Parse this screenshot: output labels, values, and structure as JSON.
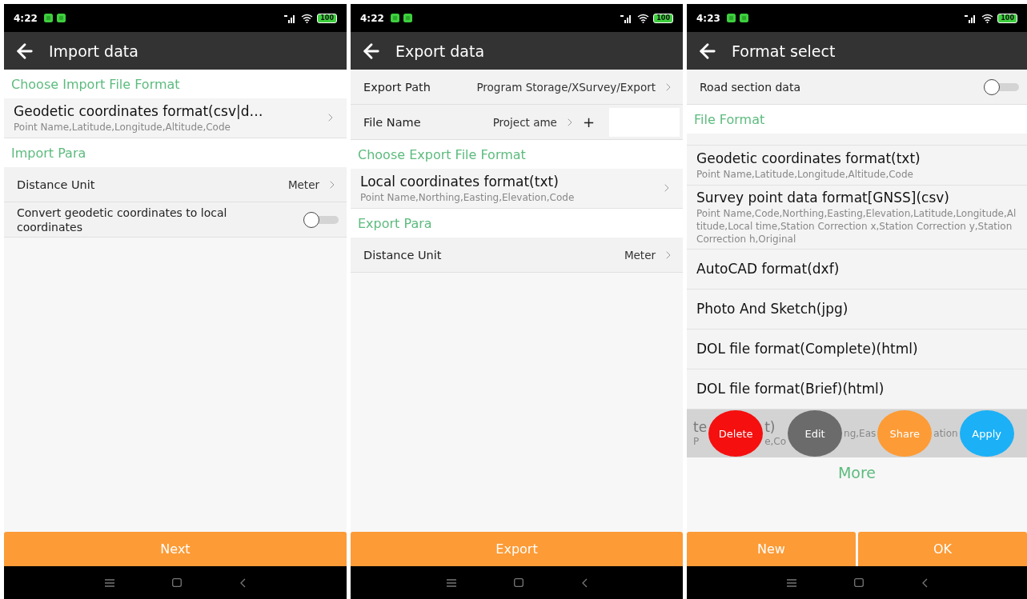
{
  "screens": [
    {
      "status": {
        "time": "4:22",
        "battery": "100"
      },
      "title": "Import data",
      "rows": [
        {
          "kind": "section",
          "label": "Choose Import File Format"
        },
        {
          "kind": "format",
          "title": "Geodetic coordinates format(csv|d…",
          "subtitle": "Point Name,Latitude,Longitude,Altitude,Code",
          "chevron": true
        },
        {
          "kind": "section",
          "label": "Import Para"
        },
        {
          "kind": "value",
          "label": "Distance Unit",
          "value": "Meter"
        },
        {
          "kind": "toggle",
          "label": "Convert geodetic coordinates to local coordinates",
          "on": false
        }
      ],
      "buttons": [
        "Next"
      ]
    },
    {
      "status": {
        "time": "4:22",
        "battery": "100"
      },
      "title": "Export data",
      "rows": [
        {
          "kind": "value",
          "label": "Export Path",
          "value": "Program Storage/XSurvey/Export"
        },
        {
          "kind": "filename",
          "label": "File Name",
          "value": "Project ame",
          "plus": "+"
        },
        {
          "kind": "section",
          "label": "Choose Export File Format"
        },
        {
          "kind": "format",
          "title": "Local coordinates format(txt)",
          "subtitle": "Point Name,Northing,Easting,Elevation,Code",
          "chevron": true
        },
        {
          "kind": "section",
          "label": "Export Para"
        },
        {
          "kind": "value",
          "label": "Distance Unit",
          "value": "Meter"
        }
      ],
      "buttons": [
        "Export"
      ]
    },
    {
      "status": {
        "time": "4:23",
        "battery": "100"
      },
      "title": "Format select",
      "rows": [
        {
          "kind": "toggle",
          "label": "Road section data",
          "on": false
        },
        {
          "kind": "section",
          "label": "File Format"
        },
        {
          "kind": "partial"
        },
        {
          "kind": "format",
          "title": "Geodetic coordinates format(txt)",
          "subtitle": "Point Name,Latitude,Longitude,Altitude,Code",
          "chevron": false
        },
        {
          "kind": "format",
          "title": "Survey point data format[GNSS](csv)",
          "subtitle": "Point Name,Code,Northing,Easting,Elevation,Latitude,Longitude,Altitude,Local time,Station Correction x,Station Correction y,Station Correction h,Original",
          "chevron": false
        },
        {
          "kind": "format",
          "title": "AutoCAD format(dxf)",
          "chevron": false
        },
        {
          "kind": "format",
          "title": "Photo And Sketch(jpg)",
          "chevron": false
        },
        {
          "kind": "format",
          "title": "DOL file format(Complete)(html)",
          "chevron": false
        },
        {
          "kind": "format",
          "title": "DOL file format(Brief)(html)",
          "chevron": false
        },
        {
          "kind": "swipe",
          "segments": [
            {
              "kind": "text",
              "title": "te",
              "subtitle": "P"
            },
            {
              "kind": "action",
              "label": "Delete",
              "color": "#f50f0f"
            },
            {
              "kind": "text",
              "title": "t)",
              "subtitle": "e,Co"
            },
            {
              "kind": "action",
              "label": "Edit",
              "color": "#6b6b6b"
            },
            {
              "kind": "text",
              "subtitle": "ng,Eas"
            },
            {
              "kind": "action",
              "label": "Share",
              "color": "#fd9b36"
            },
            {
              "kind": "text",
              "subtitle": "ation"
            },
            {
              "kind": "action",
              "label": "Apply",
              "color": "#1cb0f6"
            }
          ]
        },
        {
          "kind": "link",
          "label": "More"
        }
      ],
      "buttons": [
        "New",
        "OK"
      ]
    }
  ]
}
